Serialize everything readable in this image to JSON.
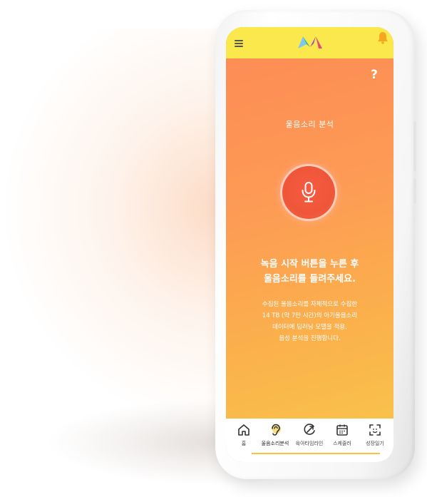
{
  "screen": {
    "title": "울음소리 분석",
    "help_label": "?",
    "headline_line1": "녹음 시작 버튼을 누른 후",
    "headline_line2": "울음소리를 들려주세요.",
    "description_lines": [
      "수집된 울음소리를 자체적으로 수집한",
      "14 TB (약 7만 시간)의 아기울음소리",
      "데이터에 딥러닝 모델을 적용,",
      "음성 분석을 진행합니다."
    ]
  },
  "topbar": {
    "icons": [
      "menu-icon",
      "app-logo",
      "bell-icon"
    ]
  },
  "nav": {
    "items": [
      {
        "label": "홈",
        "icon": "home-icon"
      },
      {
        "label": "울음소리분석",
        "icon": "ear-icon"
      },
      {
        "label": "육아타임라인",
        "icon": "timeline-icon"
      },
      {
        "label": "스케줄러",
        "icon": "calendar-icon"
      },
      {
        "label": "성장일기",
        "icon": "face-scan-icon"
      }
    ],
    "active_index": 1
  },
  "colors": {
    "topbar": "#fbe84c",
    "gradient_top": "#fd8a55",
    "gradient_bottom": "#f8c84a",
    "mic_button": "#ef5639",
    "accent": "#f7c23c"
  }
}
